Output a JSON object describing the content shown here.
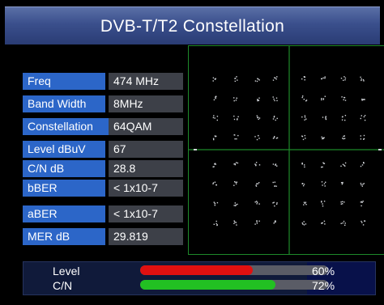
{
  "title": "DVB-T/T2 Constellation",
  "info": [
    {
      "label": "Freq",
      "value": "474 MHz"
    },
    {
      "label": "Band Width",
      "value": "8MHz"
    },
    {
      "label": "Constellation",
      "value": "64QAM"
    },
    {
      "label": "Level dBuV",
      "value": "67"
    },
    {
      "label": "C/N dB",
      "value": "28.8"
    },
    {
      "label": "bBER",
      "value": "< 1x10-7"
    },
    {
      "label": "aBER",
      "value": "< 1x10-7"
    },
    {
      "label": "MER dB",
      "value": "29.819"
    }
  ],
  "meters": {
    "level": {
      "label": "Level",
      "percent_text": "60%",
      "percent": 60,
      "color": "#e01010"
    },
    "cn": {
      "label": "C/N",
      "percent_text": "72%",
      "percent": 72,
      "color": "#22c022"
    }
  },
  "colors": {
    "title_bar": "#3a4f8c",
    "label_bg": "#2c66c8",
    "value_bg": "#3d4048",
    "plot_line": "#1e8a2a"
  }
}
